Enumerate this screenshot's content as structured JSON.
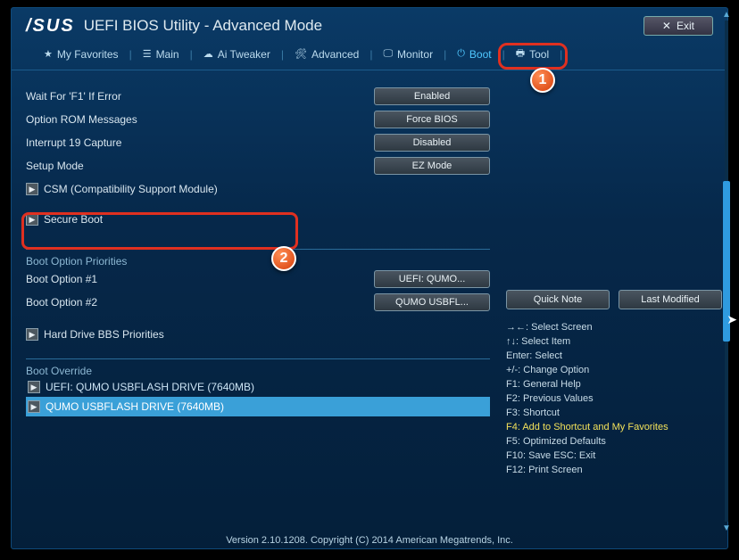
{
  "header": {
    "brand": "/SUS",
    "title": "UEFI BIOS Utility - Advanced Mode",
    "exit": "Exit"
  },
  "nav": {
    "favorites": "My Favorites",
    "main": "Main",
    "ai_tweaker": "Ai Tweaker",
    "advanced": "Advanced",
    "monitor": "Monitor",
    "boot": "Boot",
    "tool": "Tool"
  },
  "settings": {
    "wait_f1": {
      "label": "Wait For 'F1' If Error",
      "value": "Enabled"
    },
    "option_rom": {
      "label": "Option ROM Messages",
      "value": "Force BIOS"
    },
    "int19": {
      "label": "Interrupt 19 Capture",
      "value": "Disabled"
    },
    "setup_mode": {
      "label": "Setup Mode",
      "value": "EZ Mode"
    },
    "csm": "CSM (Compatibility Support Module)",
    "secure_boot": "Secure Boot"
  },
  "priorities": {
    "title": "Boot Option Priorities",
    "opt1": {
      "label": "Boot Option #1",
      "value": "UEFI: QUMO..."
    },
    "opt2": {
      "label": "Boot Option #2",
      "value": "QUMO USBFL..."
    },
    "hdd_bbs": "Hard Drive BBS Priorities"
  },
  "override": {
    "title": "Boot Override",
    "item1": "UEFI: QUMO USBFLASH DRIVE (7640MB)",
    "item2": "QUMO USBFLASH DRIVE  (7640MB)"
  },
  "side": {
    "quick_note": "Quick Note",
    "last_modified": "Last Modified"
  },
  "help": {
    "l1": "→←: Select Screen",
    "l2": "↑↓: Select Item",
    "l3": "Enter: Select",
    "l4": "+/-: Change Option",
    "l5": "F1: General Help",
    "l6": "F2: Previous Values",
    "l7": "F3: Shortcut",
    "l8": "F4: Add to Shortcut and My Favorites",
    "l9": "F5: Optimized Defaults",
    "l10": "F10: Save  ESC: Exit",
    "l11": "F12: Print Screen"
  },
  "footer": "Version 2.10.1208. Copyright (C) 2014 American Megatrends, Inc.",
  "markers": {
    "m1": "1",
    "m2": "2"
  }
}
